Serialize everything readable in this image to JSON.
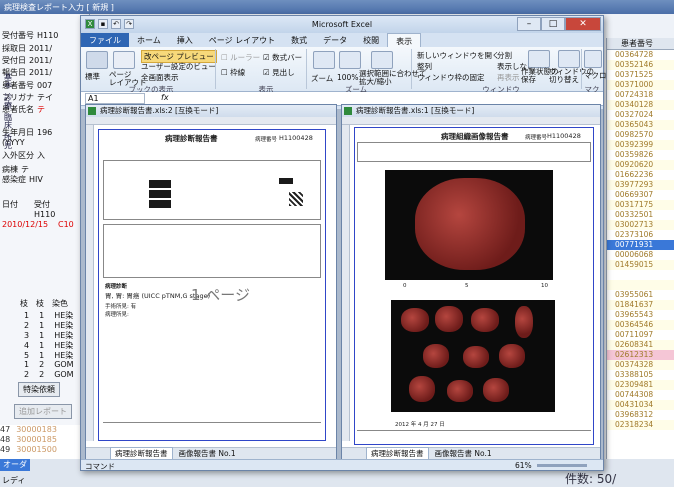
{
  "bg": {
    "title": "病理検査レポート入力 [ 新規 ]",
    "left_rows": [
      {
        "label": "受付番号",
        "value": "H110"
      },
      {
        "label": "採取日",
        "value": "2011/"
      },
      {
        "label": "受付日",
        "value": "2011/"
      },
      {
        "label": "報告日",
        "value": "2011/"
      },
      {
        "label": "患者番号",
        "value": "007"
      },
      {
        "label": "フリガナ",
        "value": "テイ"
      },
      {
        "label": "患者氏名",
        "value": "テ"
      },
      {
        "label": "生年月日",
        "value": "196"
      },
      {
        "label": "(YYYY",
        "value": ""
      },
      {
        "label": "入外区分",
        "value": "入"
      },
      {
        "label": "病棟",
        "value": "テ"
      },
      {
        "label": "感染症",
        "value": "HIV"
      }
    ],
    "side_tabs": [
      "基本",
      "診療",
      "臨床",
      "所見"
    ],
    "date_header": "日付",
    "date_header2": "受付",
    "date_value": "2010/12/15",
    "date_code": "C10",
    "date_code2": "H110",
    "table_header": [
      "枝",
      "枝",
      "染色"
    ],
    "table_rows": [
      [
        "1",
        "1",
        "HE染"
      ],
      [
        "2",
        "1",
        "HE染"
      ],
      [
        "3",
        "1",
        "HE染"
      ],
      [
        "4",
        "1",
        "HE染"
      ],
      [
        "5",
        "1",
        "HE染"
      ],
      [
        "1",
        "2",
        "GOM"
      ],
      [
        "2",
        "2",
        "GOM"
      ]
    ],
    "special_btn": "特染依頼",
    "add_report_btn": "追加レポート",
    "bottom_nums": [
      "47",
      "48",
      "49"
    ],
    "bottom_codes": [
      "30000183",
      "30000185",
      "30001500"
    ],
    "ord_label": "オーダ",
    "ready": "レディ",
    "count": "件数: 50/",
    "right_header": "患者番号",
    "patient_ids": [
      "00364728",
      "00352146",
      "00371525",
      "00371000",
      "00724318",
      "00340128",
      "00327024",
      "00365043",
      "00982570",
      "00392399",
      "00359826",
      "00920620",
      "01662236",
      "03977293",
      "00669307",
      "00317175",
      "00332501",
      "03002713",
      "02373106",
      "00771931",
      "00006068",
      "01459015",
      "",
      "",
      "03955061",
      "01841637",
      "03965543",
      "00364546",
      "00711097",
      "02608341",
      "02612313",
      "00374328",
      "03388105",
      "02309481",
      "00744308",
      "00431034",
      "03968312",
      "02318234"
    ],
    "selected_index": 19,
    "pink_index": 30
  },
  "excel": {
    "title": "Microsoft Excel",
    "tabs": [
      "ファイル",
      "ホーム",
      "挿入",
      "ページ レイアウト",
      "数式",
      "データ",
      "校閲",
      "表示"
    ],
    "active_tab": "表示",
    "ribbon": {
      "normal": "標準",
      "page_layout": "ページ\nレイアウト",
      "page_break": "改ページ プレビュー",
      "custom_view": "ユーザー設定のビュー",
      "full_screen": "全画面表示",
      "group_views": "ブックの表示",
      "ruler": "ルーラー",
      "formula_bar": "数式バー",
      "gridlines": "枠線",
      "headings": "見出し",
      "group_show": "表示",
      "zoom": "ズーム",
      "zoom100": "100%",
      "zoom_sel": "選択範囲に合わせて\n拡大/縮小",
      "group_zoom": "ズーム",
      "new_win": "新しいウィンドウを開く",
      "arrange": "整列",
      "freeze": "ウィンドウ枠の固定",
      "split": "分割",
      "hide": "表示しない",
      "unhide": "再表示",
      "save_ws": "作業状態の\n保存",
      "switch_win": "ウィンドウの\n切り替え",
      "group_window": "ウィンドウ",
      "macro": "マクロ",
      "group_macro": "マクロ"
    },
    "namebox": "A1",
    "fx": "fx",
    "left_sheet": {
      "title": "病理診断報告書.xls:2 [互換モード]",
      "report_title": "病理診断報告書",
      "report_no_label": "病理番号",
      "report_no": "H1100428",
      "diagnosis_label": "病理診断",
      "diagnosis": "胃, 胃: 胃癌 (UICC pTNM,G stage)",
      "op_label": "手術所見: 有",
      "stage_label": "病理所見:",
      "ghost": "1 ページ",
      "tabs": [
        "病理診断報告書",
        "画像報告書 No.1"
      ]
    },
    "right_sheet": {
      "title": "病理診断報告書.xls:1 [互換モード]",
      "report_title": "病理組織画像報告書",
      "report_no_label": "病理番号",
      "report_no": "H1100428",
      "scale_left": "0",
      "scale_mid": "5",
      "scale_right": "10",
      "date": "2012 年 4 月 27 日",
      "tabs": [
        "病理診断報告書",
        "画像報告書 No.1"
      ]
    },
    "status_left": "コマンド",
    "zoom_pct": "61%"
  }
}
